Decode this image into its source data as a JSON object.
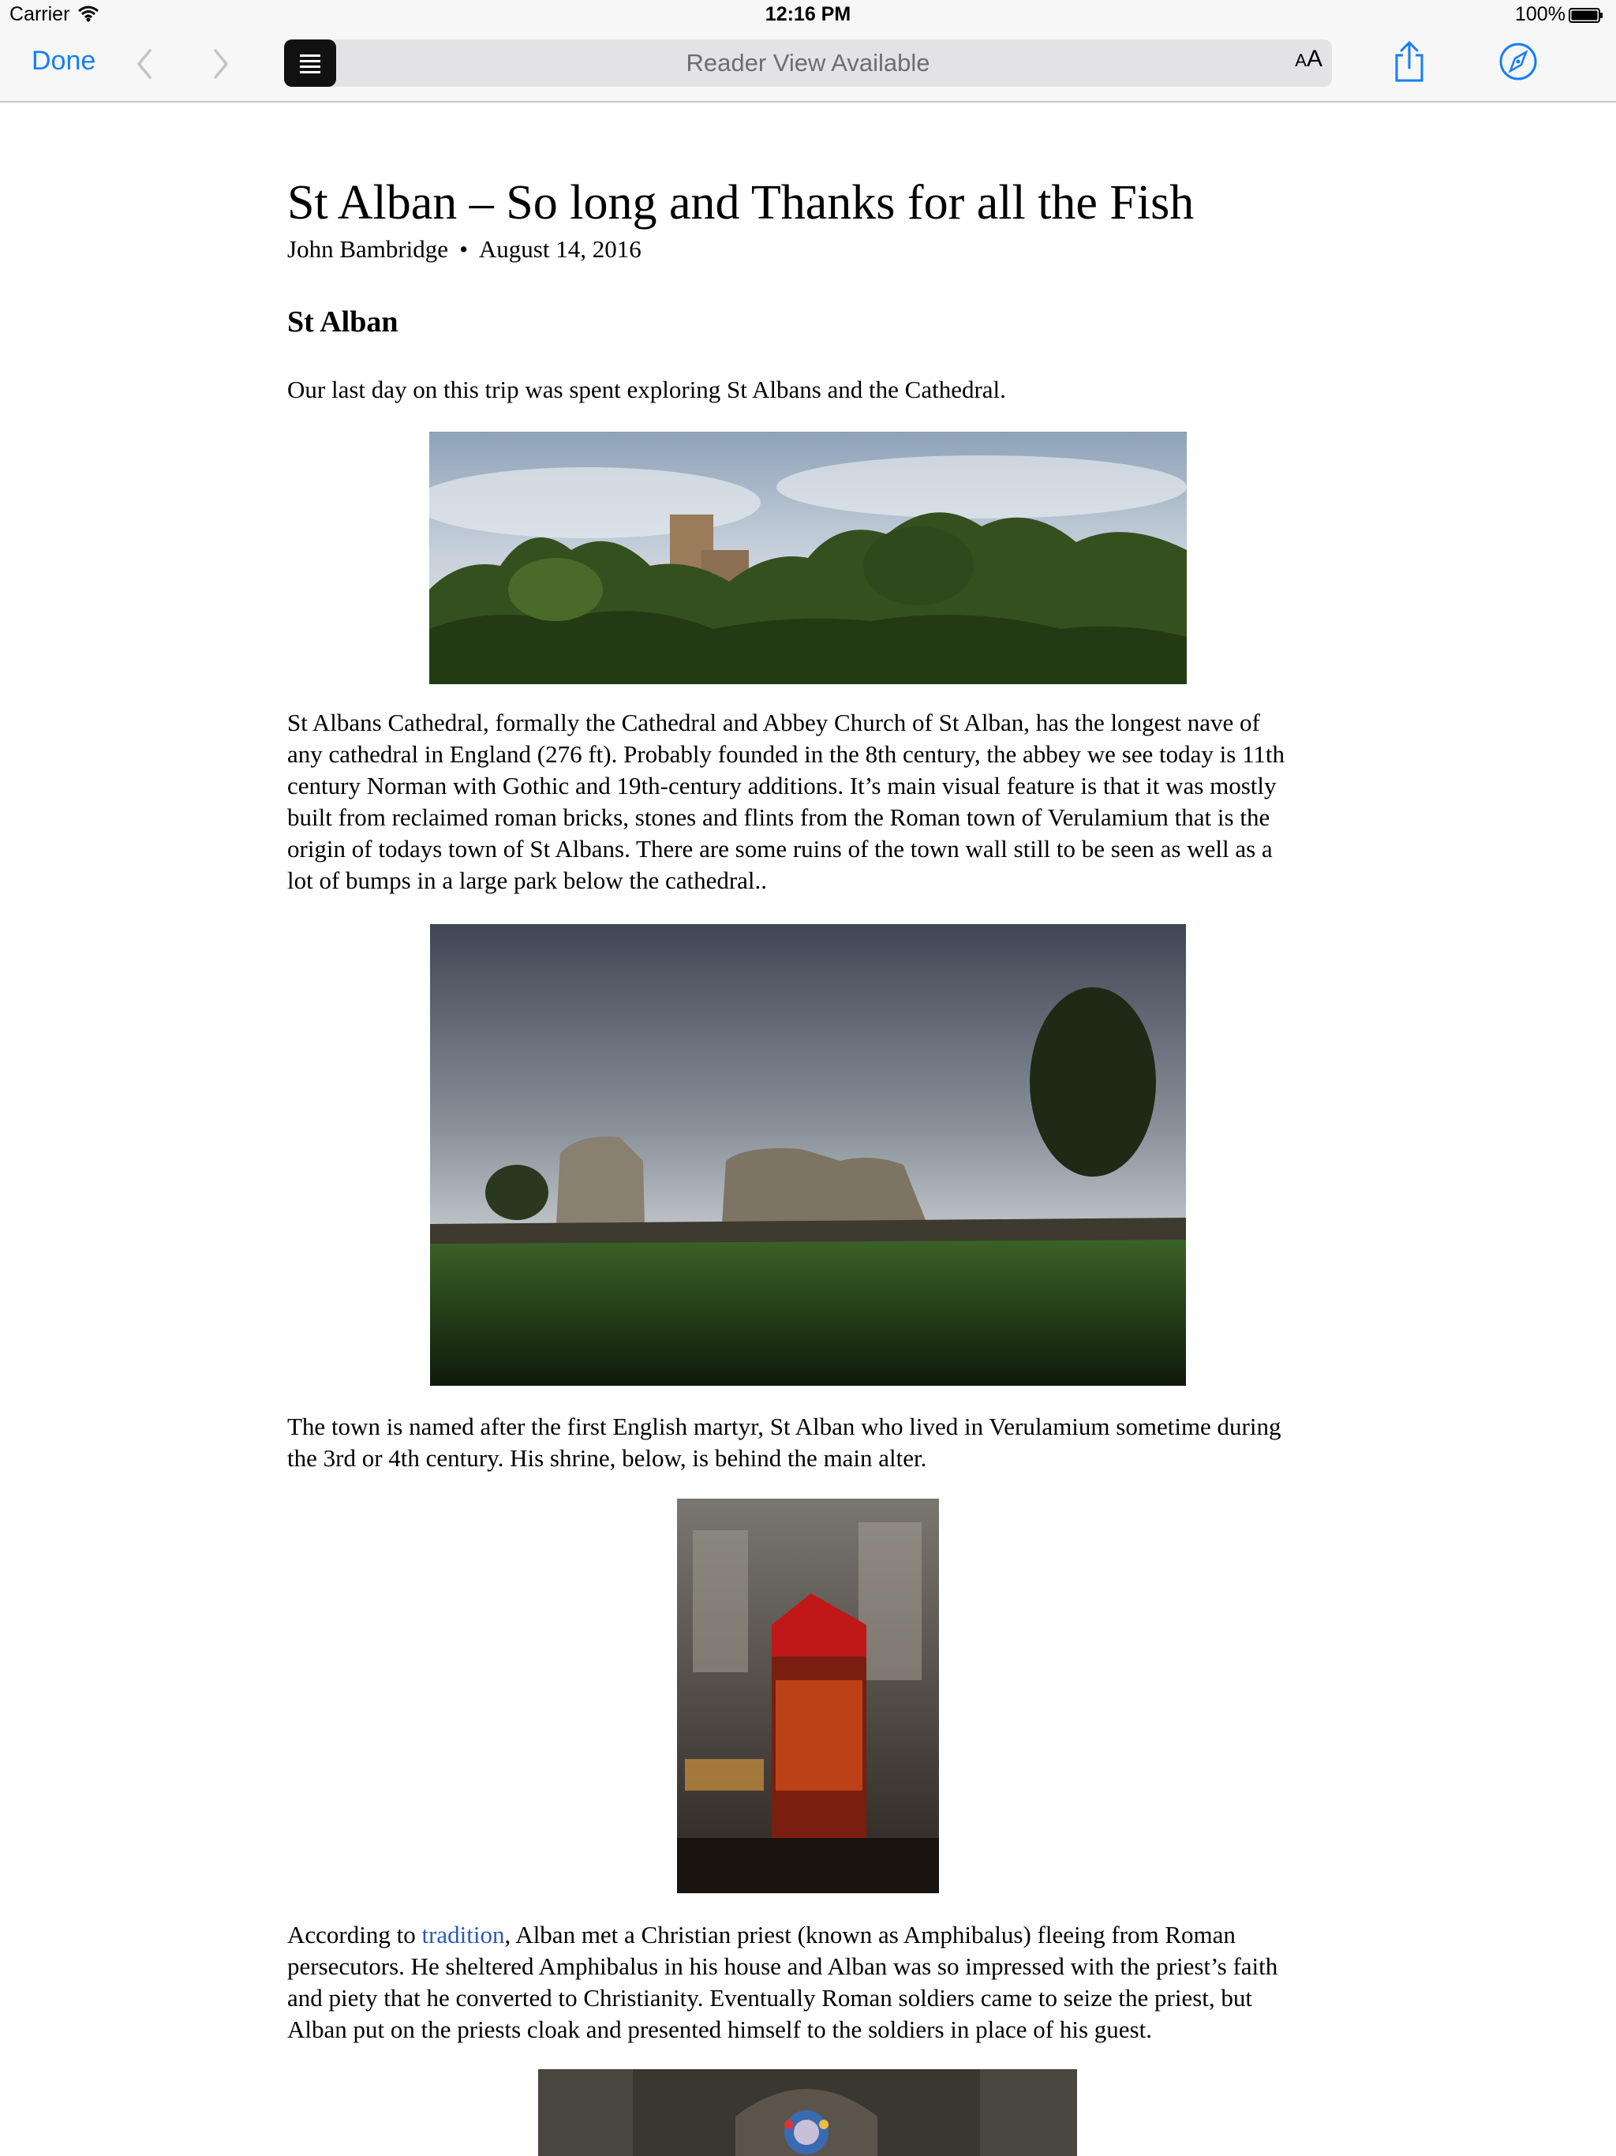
{
  "status_bar": {
    "carrier": "Carrier",
    "time": "12:16 PM",
    "battery": "100%"
  },
  "toolbar": {
    "done_label": "Done",
    "address_text": "Reader View Available",
    "text_size_label": "AA"
  },
  "article": {
    "title": "St Alban – So long and Thanks for all the Fish",
    "author": "John Bambridge",
    "byline_separator": "•",
    "date": "August 14, 2016",
    "section_heading": "St Alban",
    "paragraphs": [
      "Our last day on this trip was spent exploring St Albans and the Cathedral.",
      [
        "St Albans Cathedral, formally the Cathedral and Abbey Church of St Alban, has the longest nave of",
        "any cathedral in England (276 ft). Probably founded in the 8th century, the abbey we see today is 11th",
        "century Norman with Gothic and 19th-century additions.  It’s main visual feature is that it was mostly",
        "built from reclaimed roman bricks, stones and flints from the Roman town of Verulamium  that is the",
        "origin of todays town of St Albans. There are some ruins of the town wall still to be seen as well as a",
        "lot of bumps in a large park below the cathedral.."
      ],
      [
        "The town is named after the first English martyr, St Alban who lived in Verulamium sometime during",
        "the 3rd or 4th century. His shrine, below, is behind the main alter."
      ]
    ],
    "p4": {
      "prefix": "According to ",
      "link": "tradition",
      "line1_rest": ", Alban met a Christian priest (known as Amphibalus) fleeing from Roman",
      "lines": [
        "persecutors.  He sheltered Amphibalus in his house and Alban was so impressed with the priest’s faith",
        "and piety that he converted to Christianity.  Eventually Roman soldiers came to seize the priest, but",
        "Alban put on the priests cloak and presented himself to the soldiers in place of his guest."
      ]
    }
  },
  "icons": [
    "wifi-icon",
    "battery-icon",
    "back-chevron-icon",
    "forward-chevron-icon",
    "reader-view-icon",
    "share-icon",
    "compass-icon"
  ],
  "colors": {
    "tint": "#157efb",
    "link": "#2a5ab8",
    "bar": "#f7f7f7"
  }
}
